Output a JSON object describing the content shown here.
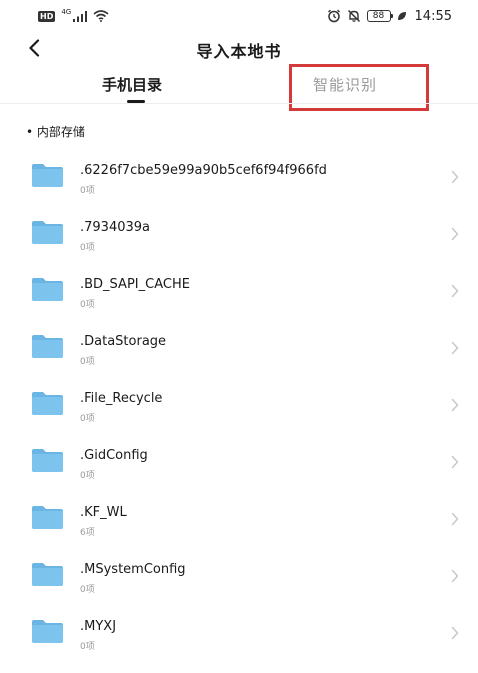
{
  "status_bar": {
    "hd": "HD",
    "network": "4G",
    "battery": "88",
    "time": "14:55"
  },
  "header": {
    "title": "导入本地书"
  },
  "tabs": [
    {
      "label": "手机目录",
      "active": true
    },
    {
      "label": "智能识别",
      "active": false
    }
  ],
  "section": {
    "label": "• 内部存储"
  },
  "folders": [
    {
      "name": ".6226f7cbe59e99a90b5cef6f94f966fd",
      "count": "0项"
    },
    {
      "name": ".7934039a",
      "count": "0项"
    },
    {
      "name": ".BD_SAPI_CACHE",
      "count": "0项"
    },
    {
      "name": ".DataStorage",
      "count": "0项"
    },
    {
      "name": ".File_Recycle",
      "count": "0项"
    },
    {
      "name": ".GidConfig",
      "count": "0项"
    },
    {
      "name": ".KF_WL",
      "count": "6项"
    },
    {
      "name": ".MSystemConfig",
      "count": "0项"
    },
    {
      "name": ".MYXJ",
      "count": "0项"
    }
  ],
  "colors": {
    "folder": "#7cc3ee",
    "folder_tab": "#6ab5e4",
    "highlight": "#d43a3a",
    "muted_text": "#9a9a9a"
  },
  "icons": {
    "back": "chevron-left-icon",
    "folder": "folder-icon",
    "row_arrow": "chevron-right-icon"
  }
}
